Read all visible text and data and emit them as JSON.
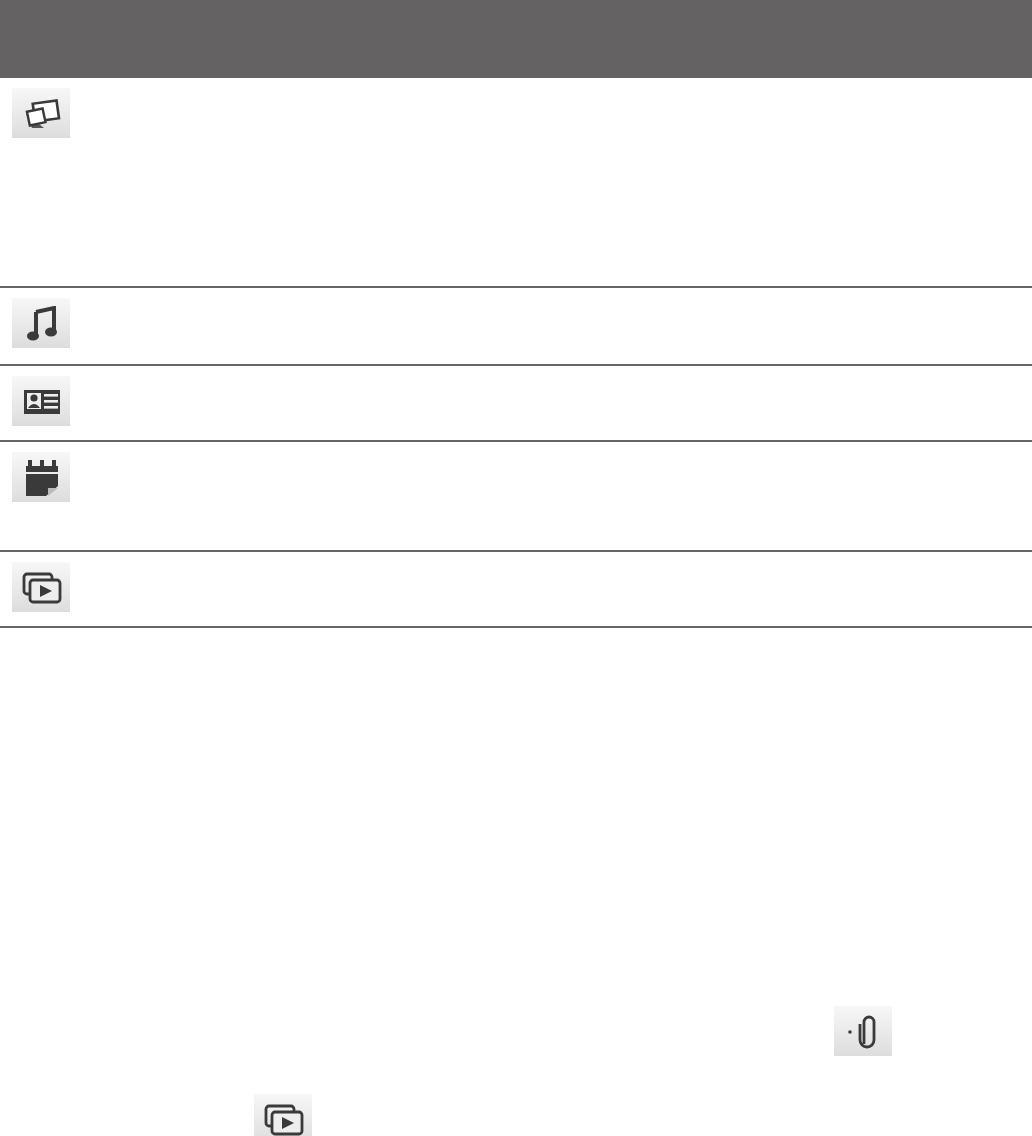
{
  "header": {
    "kind": "bar"
  },
  "rows": [
    {
      "kind": "photos"
    },
    {
      "kind": "music"
    },
    {
      "kind": "contact"
    },
    {
      "kind": "calendar"
    },
    {
      "kind": "video"
    }
  ],
  "inline_icons": [
    {
      "kind": "attach"
    },
    {
      "kind": "video"
    }
  ]
}
